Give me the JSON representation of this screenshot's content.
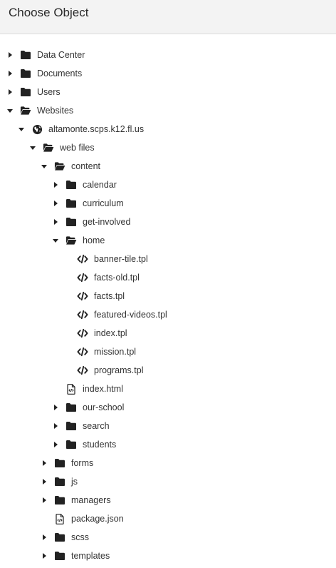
{
  "header": {
    "title": "Choose Object"
  },
  "tree": [
    {
      "label": "Data Center",
      "type": "folder",
      "state": "collapsed",
      "depth": 0
    },
    {
      "label": "Documents",
      "type": "folder",
      "state": "collapsed",
      "depth": 0
    },
    {
      "label": "Users",
      "type": "folder",
      "state": "collapsed",
      "depth": 0
    },
    {
      "label": "Websites",
      "type": "folder",
      "state": "expanded",
      "depth": 0
    },
    {
      "label": "altamonte.scps.k12.fl.us",
      "type": "globe",
      "state": "expanded",
      "depth": 1
    },
    {
      "label": "web files",
      "type": "folder",
      "state": "expanded",
      "depth": 2
    },
    {
      "label": "content",
      "type": "folder",
      "state": "expanded",
      "depth": 3
    },
    {
      "label": "calendar",
      "type": "folder",
      "state": "collapsed",
      "depth": 4
    },
    {
      "label": "curriculum",
      "type": "folder",
      "state": "collapsed",
      "depth": 4
    },
    {
      "label": "get-involved",
      "type": "folder",
      "state": "collapsed",
      "depth": 4
    },
    {
      "label": "home",
      "type": "folder",
      "state": "expanded",
      "depth": 4
    },
    {
      "label": "banner-tile.tpl",
      "type": "code",
      "state": "none",
      "depth": 5
    },
    {
      "label": "facts-old.tpl",
      "type": "code",
      "state": "none",
      "depth": 5
    },
    {
      "label": "facts.tpl",
      "type": "code",
      "state": "none",
      "depth": 5
    },
    {
      "label": "featured-videos.tpl",
      "type": "code",
      "state": "none",
      "depth": 5
    },
    {
      "label": "index.tpl",
      "type": "code",
      "state": "none",
      "depth": 5
    },
    {
      "label": "mission.tpl",
      "type": "code",
      "state": "none",
      "depth": 5
    },
    {
      "label": "programs.tpl",
      "type": "code",
      "state": "none",
      "depth": 5
    },
    {
      "label": "index.html",
      "type": "file-code",
      "state": "none",
      "depth": 4
    },
    {
      "label": "our-school",
      "type": "folder",
      "state": "collapsed",
      "depth": 4
    },
    {
      "label": "search",
      "type": "folder",
      "state": "collapsed",
      "depth": 4
    },
    {
      "label": "students",
      "type": "folder",
      "state": "collapsed",
      "depth": 4
    },
    {
      "label": "forms",
      "type": "folder",
      "state": "collapsed",
      "depth": 3
    },
    {
      "label": "js",
      "type": "folder",
      "state": "collapsed",
      "depth": 3
    },
    {
      "label": "managers",
      "type": "folder",
      "state": "collapsed",
      "depth": 3
    },
    {
      "label": "package.json",
      "type": "file-code",
      "state": "none",
      "depth": 3
    },
    {
      "label": "scss",
      "type": "folder",
      "state": "collapsed",
      "depth": 3
    },
    {
      "label": "templates",
      "type": "folder",
      "state": "collapsed",
      "depth": 3
    }
  ]
}
